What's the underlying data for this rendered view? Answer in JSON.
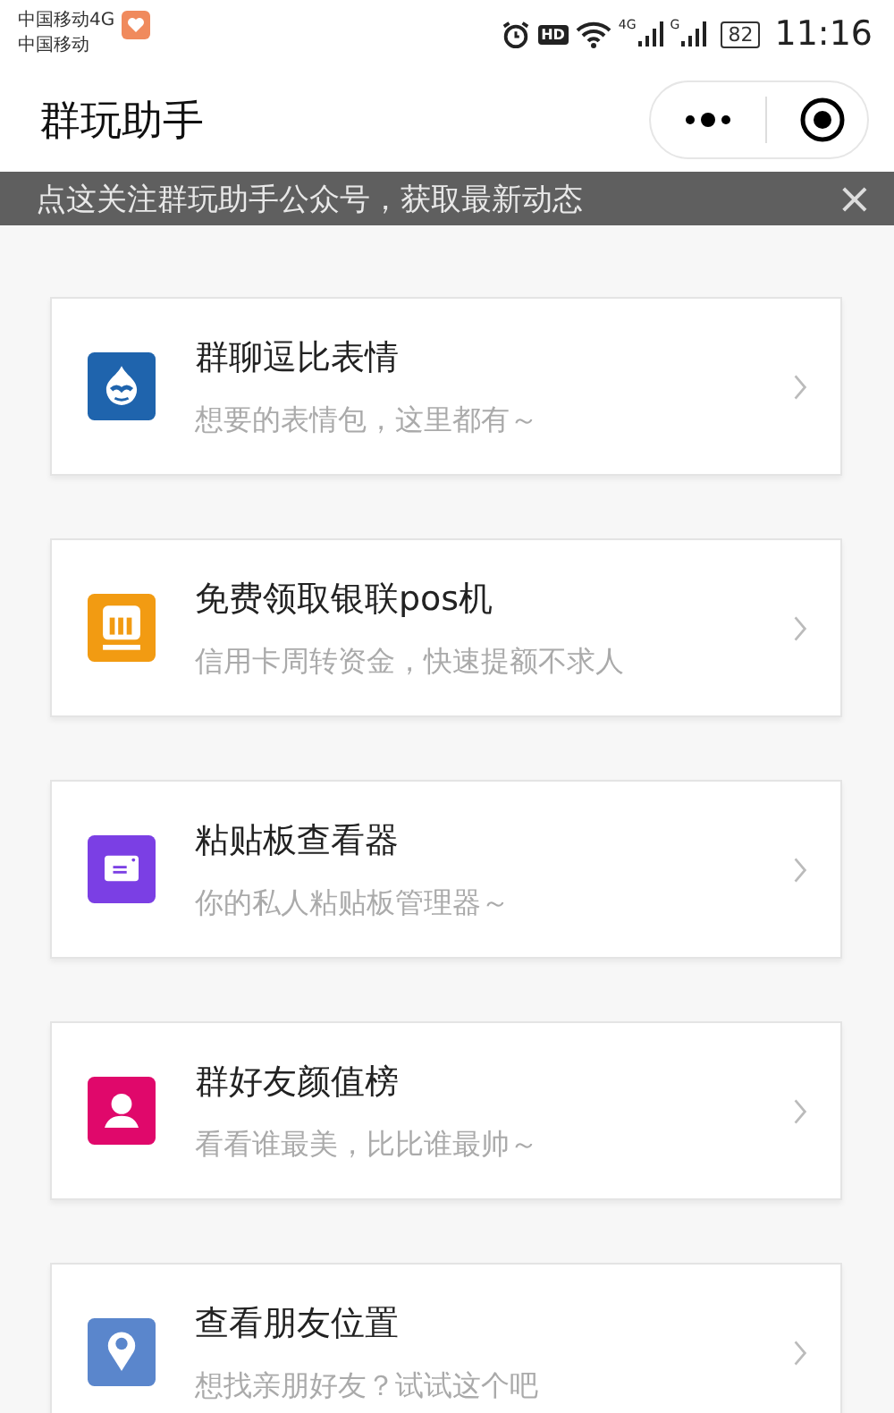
{
  "status_bar": {
    "carriers": [
      "中国移动4G",
      "中国移动"
    ],
    "hd": "HD",
    "sim1_network": "4G",
    "sim2_network": "G",
    "battery": "82",
    "time": "11:16"
  },
  "header": {
    "title": "群玩助手"
  },
  "banner": {
    "text": "点这关注群玩助手公众号，获取最新动态",
    "close": "×"
  },
  "items": [
    {
      "kind": "drop",
      "color": "#1f64ad",
      "title": "群聊逗比表情",
      "subtitle": "想要的表情包，这里都有～"
    },
    {
      "kind": "pos",
      "color": "#f29b12",
      "title": "免费领取银联pos机",
      "subtitle": "信用卡周转资金，快速提额不求人"
    },
    {
      "kind": "card",
      "color": "#7b3fe4",
      "title": "粘贴板查看器",
      "subtitle": "你的私人粘贴板管理器～"
    },
    {
      "kind": "person",
      "color": "#e0086b",
      "title": "群好友颜值榜",
      "subtitle": "看看谁最美，比比谁最帅～"
    },
    {
      "kind": "pin",
      "color": "#5a86cc",
      "title": "查看朋友位置",
      "subtitle": "想找亲朋好友？试试这个吧"
    }
  ]
}
